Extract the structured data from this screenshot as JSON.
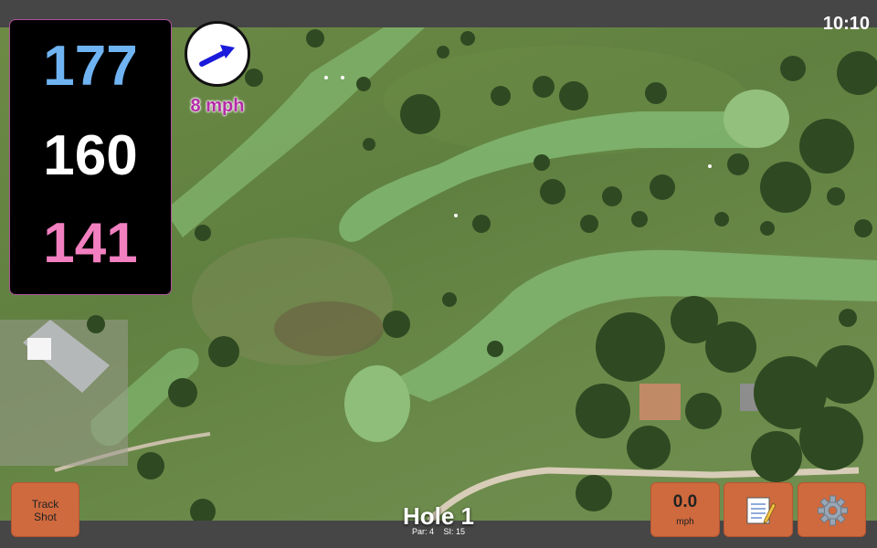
{
  "status_bar": {
    "time": "10:10"
  },
  "yardages": {
    "back": "177",
    "middle": "160",
    "front": "141"
  },
  "wind": {
    "speed": "8 mph",
    "direction_icon": "arrow-icon",
    "arrow_color": "#1a1adb"
  },
  "buttons": {
    "track_shot": {
      "line1": "Track",
      "line2": "Shot"
    },
    "speed": {
      "value": "0.0",
      "unit": "mph"
    },
    "notes_icon": "notepad-icon",
    "settings_icon": "gear-icon"
  },
  "hole": {
    "title": "Hole 1",
    "par": "Par: 4",
    "si": "SI: 15"
  },
  "colors": {
    "back_yardage": "#6fb3f2",
    "middle_yardage": "#ffffff",
    "front_yardage": "#f27fbf",
    "button_bg": "#cf6a3e",
    "wind_text": "#b52ca8"
  }
}
